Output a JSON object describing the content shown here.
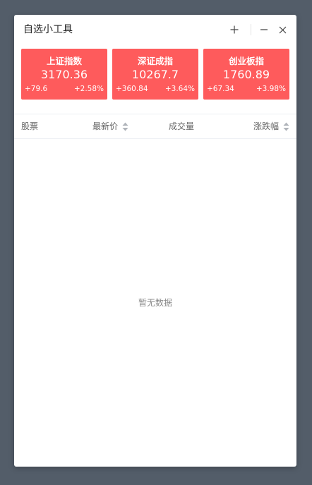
{
  "window": {
    "title": "自选小工具"
  },
  "titlebar": {
    "add_icon": "plus-icon",
    "minimize_icon": "minus-icon",
    "close_icon": "close-icon"
  },
  "indices": [
    {
      "name": "上证指数",
      "value": "3170.36",
      "change": "+79.6",
      "percent": "+2.58%"
    },
    {
      "name": "深证成指",
      "value": "10267.7",
      "change": "+360.84",
      "percent": "+3.64%"
    },
    {
      "name": "创业板指",
      "value": "1760.89",
      "change": "+67.34",
      "percent": "+3.98%"
    }
  ],
  "table": {
    "columns": {
      "stock": "股票",
      "price": "最新价",
      "volume": "成交量",
      "change": "涨跌幅"
    },
    "rows": [],
    "empty_text": "暂无数据"
  },
  "colors": {
    "card_bg": "#fe5b5c",
    "page_bg": "#535d69"
  }
}
